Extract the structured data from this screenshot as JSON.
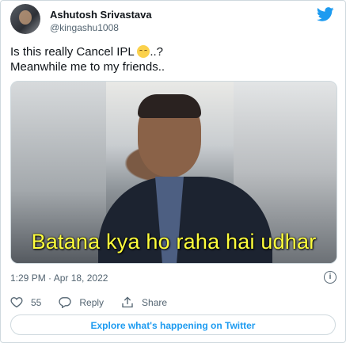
{
  "author": {
    "name": "Ashutosh Srivastava",
    "handle": "@kingashu1008"
  },
  "tweet": {
    "line1_before_emoji": "Is this really Cancel IPL ",
    "line1_emoji_icon": "pensive-face-icon",
    "line1_after_emoji": "..?",
    "line2": "Meanwhile me to my friends.."
  },
  "media": {
    "caption": "Batana kya ho raha hai udhar"
  },
  "meta": {
    "timestamp": "1:29 PM · Apr 18, 2022"
  },
  "actions": {
    "like_count": "55",
    "reply_label": "Reply",
    "share_label": "Share"
  },
  "explore_label": "Explore what's happening on Twitter",
  "colors": {
    "accent": "#1d9bf0",
    "caption": "#ffff3c",
    "muted": "#536471"
  }
}
